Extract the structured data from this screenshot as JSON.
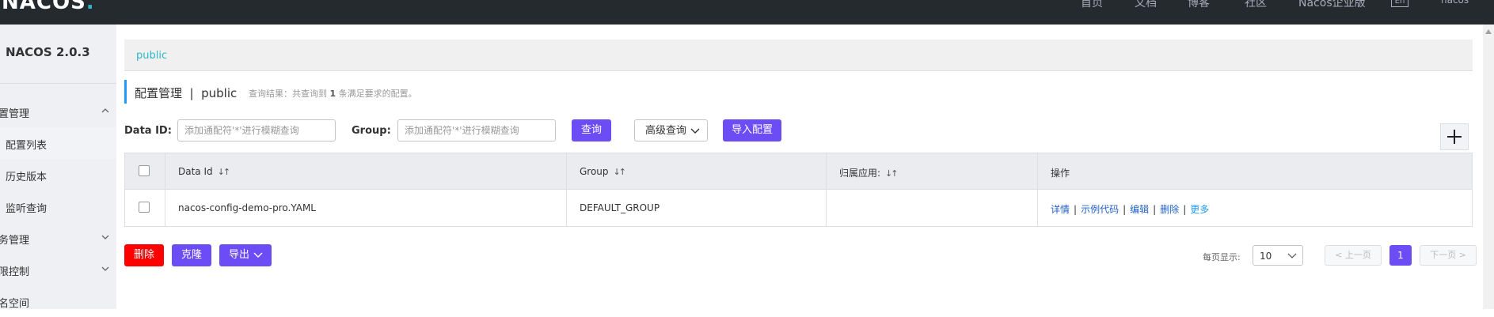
{
  "topbar": {
    "logo_text": "NACOS",
    "logo_dot": ".",
    "nav": [
      "首页",
      "文档",
      "博客",
      "社区",
      "Nacos企业版"
    ],
    "lang": "En",
    "user": "nacos"
  },
  "sidebar": {
    "title": "NACOS 2.0.3",
    "items": [
      {
        "label": "置管理",
        "type": "top",
        "icon": "chevron-up-icon"
      },
      {
        "label": "配置列表",
        "type": "sub"
      },
      {
        "label": "历史版本",
        "type": "sub"
      },
      {
        "label": "监听查询",
        "type": "sub"
      },
      {
        "label": "务管理",
        "type": "top",
        "icon": "chevron-down-icon"
      },
      {
        "label": "限控制",
        "type": "top",
        "icon": "chevron-down-icon"
      },
      {
        "label": "名空间",
        "type": "top"
      }
    ]
  },
  "breadcrumb": {
    "namespace": "public"
  },
  "header": {
    "title": "配置管理  |  public",
    "query_prefix": "查询结果：共查询到",
    "query_count": "1",
    "query_suffix": "条满足要求的配置。"
  },
  "filter": {
    "dataid_label": "Data ID:",
    "dataid_placeholder": "添加通配符'*'进行模糊查询",
    "group_label": "Group:",
    "group_placeholder": "添加通配符'*'进行模糊查询",
    "query_btn": "查询",
    "advanced_btn": "高级查询",
    "import_btn": "导入配置"
  },
  "table": {
    "columns": [
      "Data Id",
      "Group",
      "归属应用:",
      "操作"
    ],
    "rows": [
      {
        "data_id": "nacos-config-demo-pro.YAML",
        "group": "DEFAULT_GROUP",
        "app": ""
      }
    ],
    "actions": [
      "详情",
      "示例代码",
      "编辑",
      "删除",
      "更多"
    ]
  },
  "bottom": {
    "delete_btn": "删除",
    "clone_btn": "克隆",
    "export_btn": "导出",
    "page_size_label": "每页显示:",
    "page_size": "10",
    "prev": "上一页",
    "current_page": "1",
    "next": "下一页"
  },
  "colors": {
    "primary": "#6c4cf5",
    "danger": "#ff0000",
    "link": "#2462c7",
    "accent": "#209bfa",
    "topbar": "#252a2f"
  }
}
